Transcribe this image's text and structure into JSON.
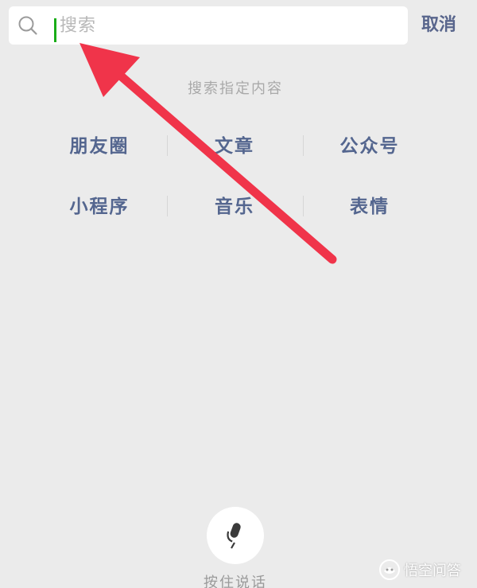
{
  "search": {
    "placeholder": "搜索",
    "cancel_label": "取消",
    "section_title": "搜索指定内容"
  },
  "categories": {
    "row1": [
      "朋友圈",
      "文章",
      "公众号"
    ],
    "row2": [
      "小程序",
      "音乐",
      "表情"
    ]
  },
  "voice": {
    "label": "按住说话"
  },
  "watermark": {
    "text": "悟空问答"
  },
  "colors": {
    "accent_caret": "#1aad19",
    "link_blue": "#54668f",
    "arrow_red": "#f0344a",
    "background": "#ebebeb"
  },
  "icons": {
    "search": "search-icon",
    "mic": "mic-icon",
    "annotation": "arrow-icon",
    "brand": "wukong-logo-icon"
  }
}
